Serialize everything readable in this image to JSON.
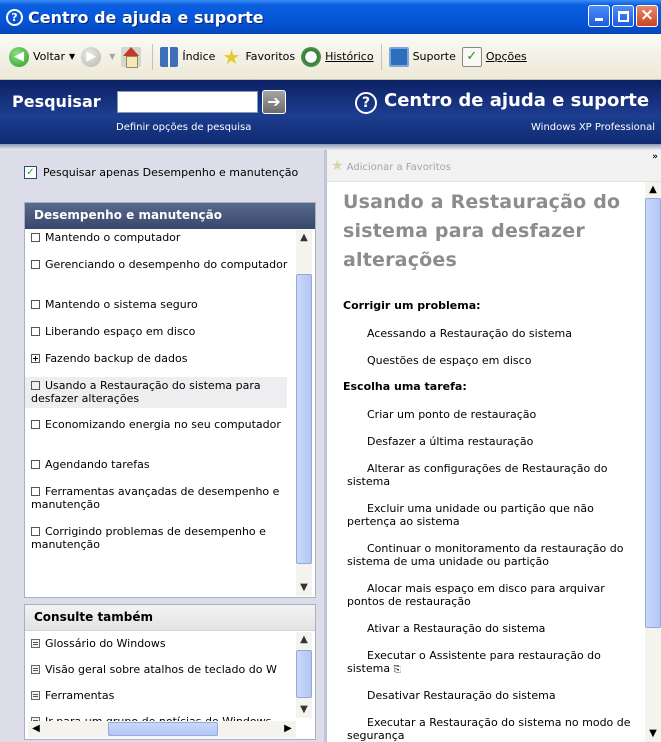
{
  "window": {
    "title": "Centro de ajuda e suporte"
  },
  "toolbar": {
    "back": "Voltar",
    "index": "Índice",
    "favorites": "Favoritos",
    "history": "Histórico",
    "support": "Suporte",
    "options": "Opções"
  },
  "search": {
    "label": "Pesquisar",
    "value": "",
    "options_link": "Definir opções de pesquisa"
  },
  "brand": {
    "title": "Centro de ajuda e suporte",
    "subtitle": "Windows XP Professional"
  },
  "left": {
    "restrict_label": "Pesquisar apenas Desempenho e manutenção",
    "restrict_checked": true,
    "category": {
      "title": "Desempenho e manutenção",
      "items": [
        {
          "label": "Mantendo o computador",
          "icon": "topic-icon"
        },
        {
          "label": "Gerenciando o desempenho do computador",
          "icon": "topic-icon"
        },
        {
          "label": "Mantendo o sistema seguro",
          "icon": "topic-icon"
        },
        {
          "label": "Liberando espaço em disco",
          "icon": "topic-icon"
        },
        {
          "label": "Fazendo backup de dados",
          "icon": "expand-icon"
        },
        {
          "label": "Usando a Restauração do sistema para desfazer alterações",
          "icon": "topic-icon",
          "selected": true
        },
        {
          "label": "Economizando energia no seu computador",
          "icon": "topic-icon"
        },
        {
          "label": "Agendando tarefas",
          "icon": "topic-icon"
        },
        {
          "label": "Ferramentas avançadas de desempenho e manutenção",
          "icon": "topic-icon"
        },
        {
          "label": "Corrigindo problemas de desempenho e manutenção",
          "icon": "topic-icon"
        }
      ]
    },
    "see_also": {
      "title": "Consulte também",
      "items": [
        "Glossário do Windows",
        "Visão geral sobre atalhos de teclado do W",
        "Ferramentas",
        "Ir para um grupo de notícias do Windows"
      ]
    }
  },
  "content": {
    "add_favorites": "Adicionar a Favoritos",
    "heading": "Usando a Restauração do sistema para desfazer alterações",
    "sections": [
      {
        "title": "Corrigir um problema:",
        "tasks": [
          "Acessando a Restauração do sistema",
          "Questões de espaço em disco"
        ]
      },
      {
        "title": "Escolha uma tarefa:",
        "tasks": [
          "Criar um ponto de restauração",
          "Desfazer a última restauração",
          "Alterar as configurações de Restauração do sistema",
          "Excluir uma unidade ou partição que não pertença ao sistema",
          "Continuar o monitoramento da restauração do sistema de uma unidade ou partição",
          "Alocar mais espaço em disco para arquivar pontos de restauração",
          "Ativar a Restauração do sistema",
          "Executar o Assistente para restauração do sistema",
          "Desativar Restauração do sistema",
          "Executar a Restauração do sistema no modo de segurança"
        ]
      }
    ]
  }
}
